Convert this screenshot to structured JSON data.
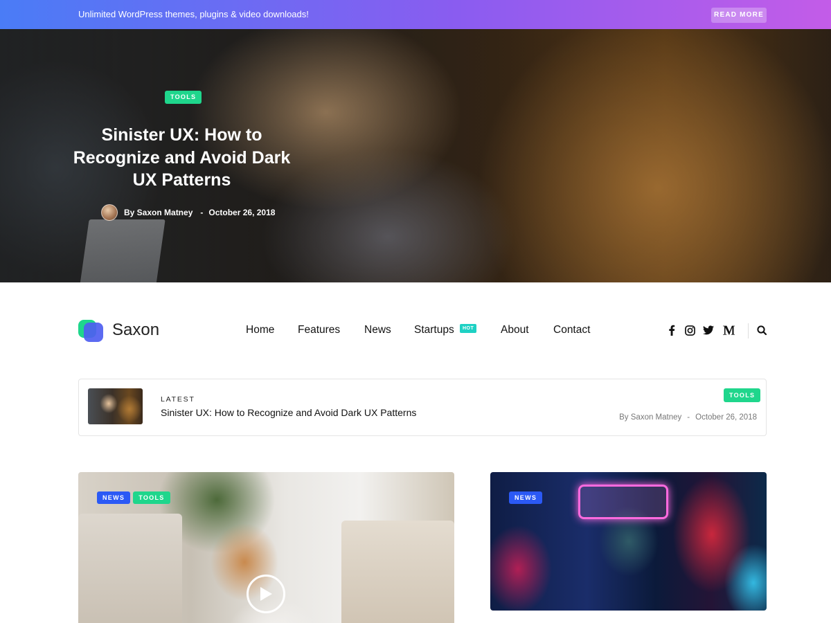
{
  "promo": {
    "text": "Unlimited WordPress themes, plugins & video downloads!",
    "button": "READ MORE"
  },
  "hero": {
    "tag": "TOOLS",
    "title": "Sinister UX: How to Recognize and Avoid Dark UX Patterns",
    "author": "By Saxon Matney",
    "separator": "-",
    "date": "October 26, 2018"
  },
  "header": {
    "brand": "Saxon",
    "nav": [
      {
        "label": "Home"
      },
      {
        "label": "Features"
      },
      {
        "label": "News"
      },
      {
        "label": "Startups",
        "badge": "HOT"
      },
      {
        "label": "About"
      },
      {
        "label": "Contact"
      }
    ],
    "social_icons": [
      "facebook-icon",
      "instagram-icon",
      "twitter-icon",
      "medium-icon"
    ],
    "search_icon": "search-icon"
  },
  "latest": {
    "label": "LATEST",
    "title": "Sinister UX: How to Recognize and Avoid Dark UX Patterns",
    "tag": "TOOLS",
    "author": "By Saxon Matney",
    "separator": "-",
    "date": "October 26, 2018"
  },
  "cards": [
    {
      "tags": [
        "NEWS",
        "TOOLS"
      ]
    },
    {
      "tags": [
        "NEWS"
      ]
    }
  ],
  "colors": {
    "accent_green": "#1fd68c",
    "accent_blue": "#2b59f5",
    "hot_badge": "#1ed1c4"
  }
}
